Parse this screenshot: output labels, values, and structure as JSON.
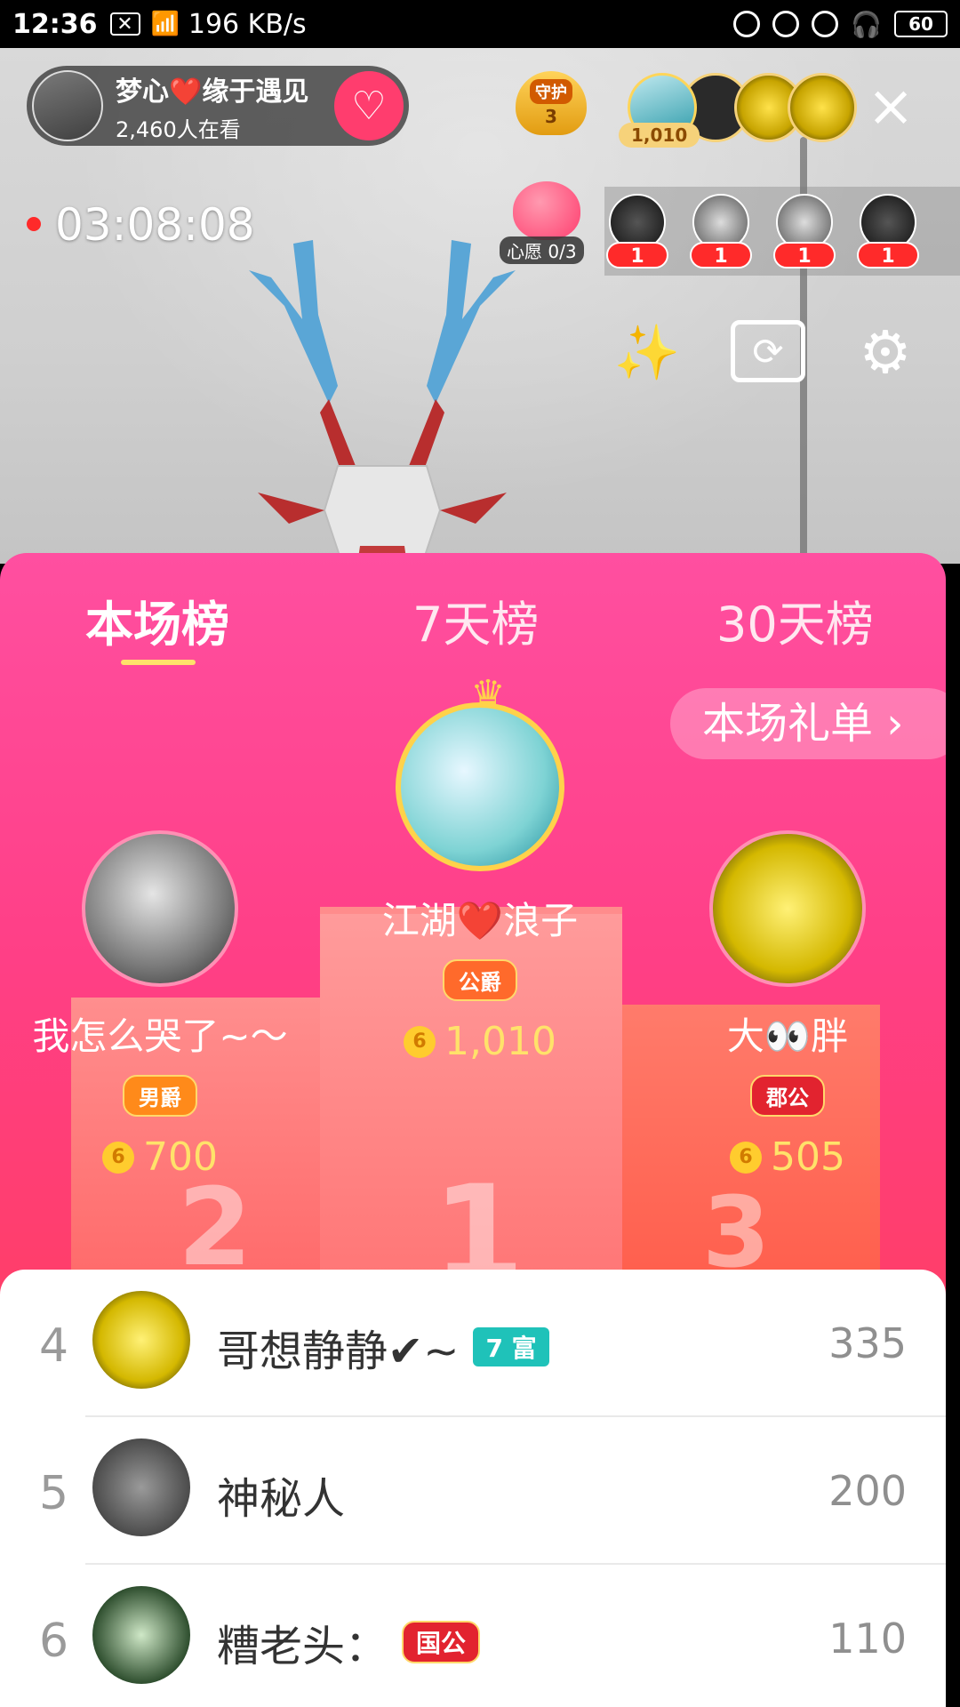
{
  "status_bar": {
    "time": "12:36",
    "network_speed": "196 KB/s",
    "battery": "60"
  },
  "host": {
    "name": "梦心❤️缘于遇见",
    "viewers": "2,460人在看"
  },
  "guard": {
    "label": "守护",
    "count": "3"
  },
  "top_viewers": {
    "first_count": "1,010"
  },
  "live": {
    "elapsed": "03:08:08"
  },
  "wish": {
    "label": "心愿 0/3"
  },
  "guests": [
    {
      "count": "1"
    },
    {
      "count": "1"
    },
    {
      "count": "1"
    },
    {
      "count": "1"
    }
  ],
  "tabs": [
    {
      "label": "本场榜"
    },
    {
      "label": "7天榜"
    },
    {
      "label": "30天榜"
    }
  ],
  "gift_list_button": "本场礼单 ›",
  "podium": {
    "first": {
      "name": "江湖❤️浪子",
      "badge": "公爵",
      "coins": "1,010"
    },
    "second": {
      "name": "我怎么哭了~〜",
      "badge": "男爵",
      "coins": "700"
    },
    "third": {
      "name": "大👀胖",
      "badge": "郡公",
      "coins": "505"
    },
    "numbers": [
      "1",
      "2",
      "3"
    ]
  },
  "ranking_list": [
    {
      "rank": "4",
      "name": "哥想静静✔~",
      "tag": "7 富",
      "score": "335"
    },
    {
      "rank": "5",
      "name": "神秘人",
      "tag": "",
      "score": "200"
    },
    {
      "rank": "6",
      "name": "糟老头：",
      "tag": "国公",
      "score": "110"
    }
  ],
  "colors": {
    "panel_pink": "#ff4fa0",
    "accent_gold": "#ffd24a",
    "live_red": "#ff2a2a",
    "rich_tag": "#1fc2b9"
  }
}
